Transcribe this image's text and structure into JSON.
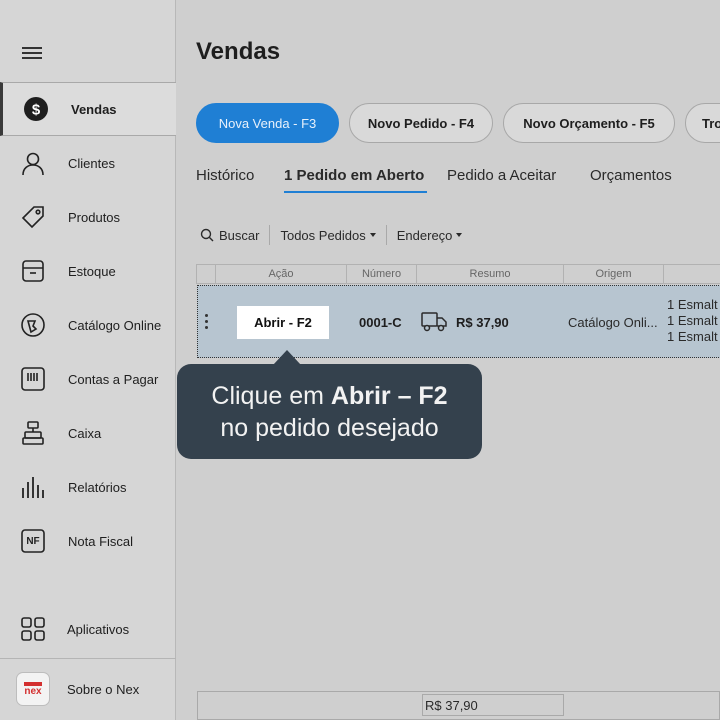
{
  "sidebar": {
    "items": [
      {
        "label": "Vendas",
        "icon": "dollar-icon"
      },
      {
        "label": "Clientes",
        "icon": "person-icon"
      },
      {
        "label": "Produtos",
        "icon": "tag-icon"
      },
      {
        "label": "Estoque",
        "icon": "box-icon"
      },
      {
        "label": "Catálogo Online",
        "icon": "catalog-icon"
      },
      {
        "label": "Contas a Pagar",
        "icon": "bills-icon"
      },
      {
        "label": "Caixa",
        "icon": "cash-register-icon"
      },
      {
        "label": "Relatórios",
        "icon": "reports-icon"
      },
      {
        "label": "Nota Fiscal",
        "icon": "nf-icon"
      }
    ],
    "apps_label": "Aplicativos",
    "about_label": "Sobre o Nex",
    "logo_text": "nex",
    "nf_text": "NF"
  },
  "main": {
    "title": "Vendas",
    "actions": [
      "Nova Venda - F3",
      "Novo Pedido - F4",
      "Novo Orçamento - F5",
      "Tro"
    ],
    "tabs": [
      "Histórico",
      "1 Pedido em Aberto",
      "Pedido a Aceitar",
      "Orçamentos"
    ],
    "filters": {
      "search": "Buscar",
      "orders": "Todos Pedidos",
      "address": "Endereço"
    },
    "columns": [
      "Ação",
      "Número",
      "Resumo",
      "Origem"
    ],
    "row": {
      "action": "Abrir - F2",
      "number": "0001-C",
      "summary": "R$ 37,90",
      "origin": "Catálogo Onli...",
      "items": [
        "1  Esmalt",
        "1  Esmalt",
        "1  Esmalt"
      ]
    },
    "footer_total": "R$ 37,90"
  },
  "tooltip": {
    "line1_prefix": "Clique em ",
    "line1_bold": "Abrir – F2",
    "line2": "no pedido desejado"
  },
  "colors": {
    "primary": "#1f7fd4",
    "tooltip": "#34414d",
    "selected_row": "#b7c5d0",
    "brand_red": "#d32f2f"
  }
}
